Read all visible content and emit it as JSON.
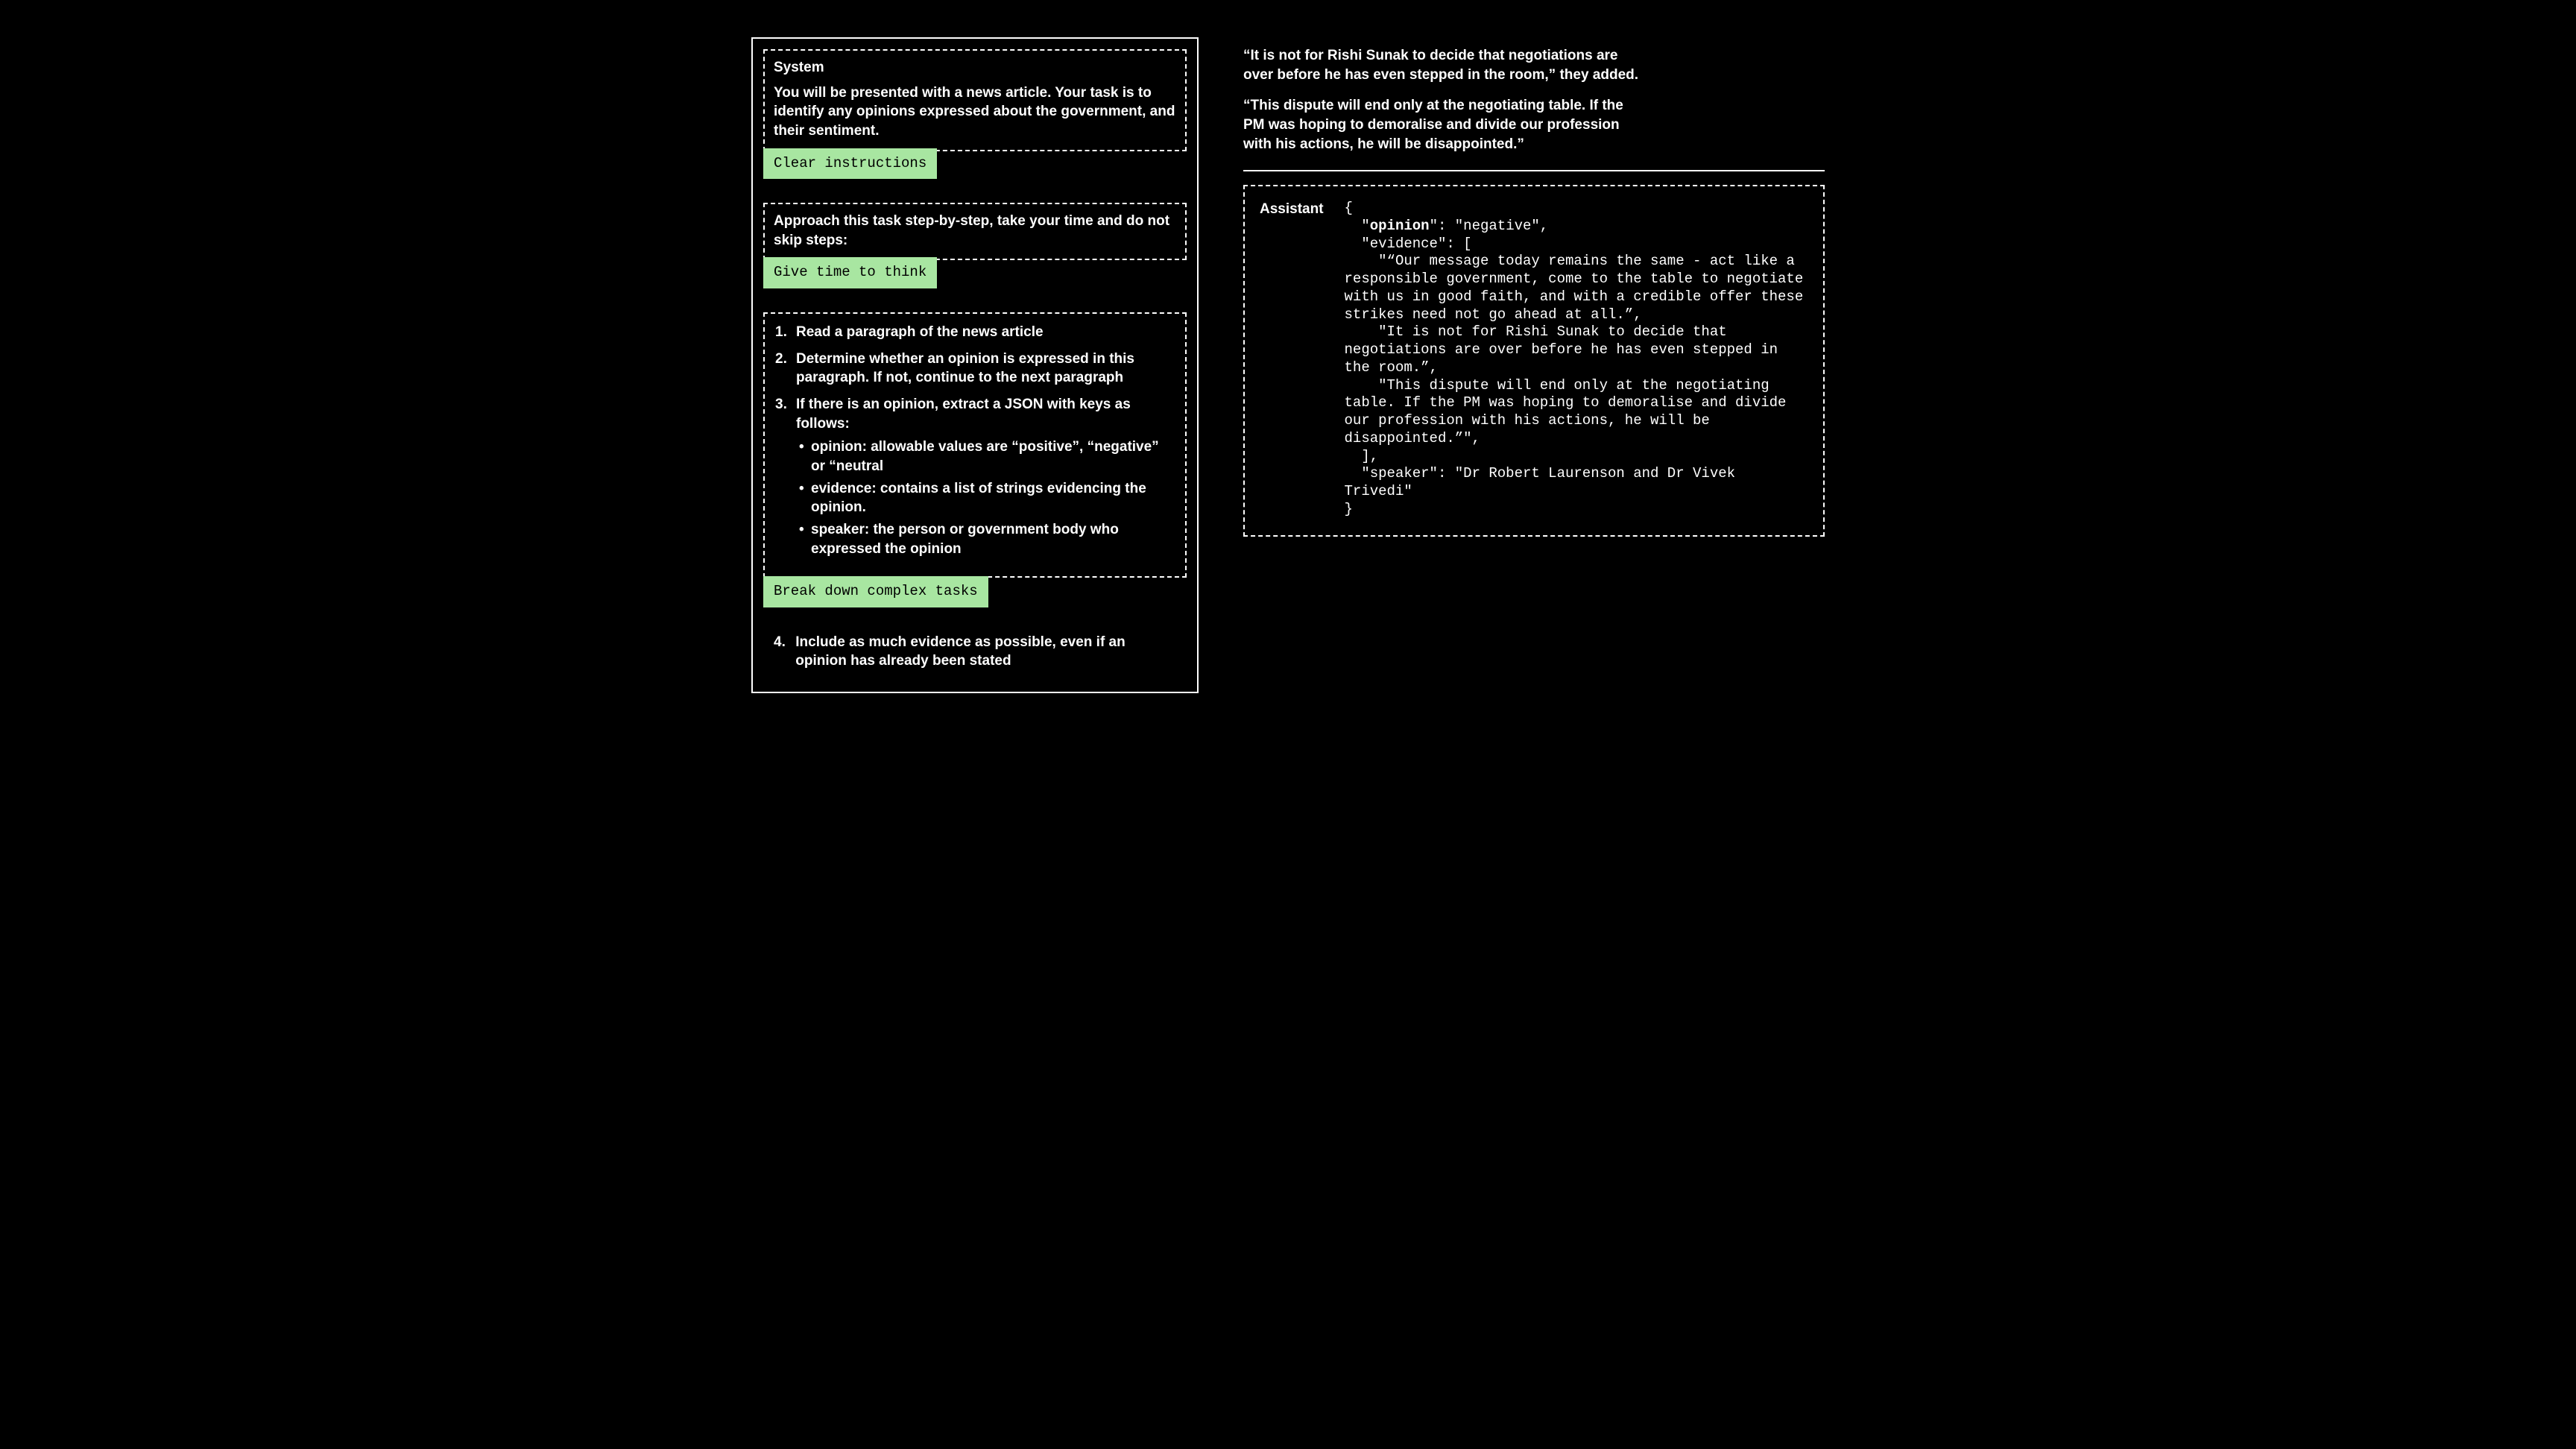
{
  "left": {
    "system": {
      "title": "System",
      "body": "You will be presented with a news article. Your task is to identify any opinions expressed about the government, and their sentiment."
    },
    "tag1": "Clear instructions",
    "approach": "Approach this task step-by-step, take your time and do not skip steps:",
    "tag2": "Give time to think",
    "steps": {
      "s1": "Read a paragraph of the news article",
      "s2": "Determine whether an opinion is expressed in this paragraph. If not, continue to the next paragraph",
      "s3": "If there is an opinion, extract a JSON with keys as follows:",
      "b1": "opinion: allowable values are “positive”, “negative” or “neutral",
      "b2": "evidence: contains a list of strings evidencing the opinion.",
      "b3": "speaker: the person or government body who expressed the opinion"
    },
    "tag3": "Break down complex tasks",
    "step4_num": "4.",
    "step4_txt": "Include as much evidence as possible, even if an opinion has already been stated"
  },
  "right": {
    "article": {
      "p1": "“It is not for Rishi Sunak to decide that negotiations are over before he has even stepped in the room,” they added.",
      "p2": "“This dispute will end only at the negotiating table. If the PM was hoping to demoralise and divide our profession with his actions, he will be disappointed.”"
    },
    "assistant": {
      "label": "Assistant",
      "code": {
        "l0": "{",
        "l1a": "  \"",
        "l1key": "opinion",
        "l1b": "\": \"negative\",",
        "l2": "  \"evidence\": [",
        "l3": "    \"“Our message today remains the same - act like a responsible government, come to the table to negotiate with us in good faith, and with a credible offer these strikes need not go ahead at all.”,",
        "l4": "    \"It is not for Rishi Sunak to decide that negotiations are over before he has even stepped in the room.”,",
        "l5": "    \"This dispute will end only at the negotiating table. If the PM was hoping to demoralise and divide our profession with his actions, he will be disappointed.”\",",
        "l6": "  ],",
        "l7": "  \"speaker\": \"Dr Robert Laurenson and Dr Vivek Trivedi\"",
        "l8": "}"
      }
    }
  }
}
